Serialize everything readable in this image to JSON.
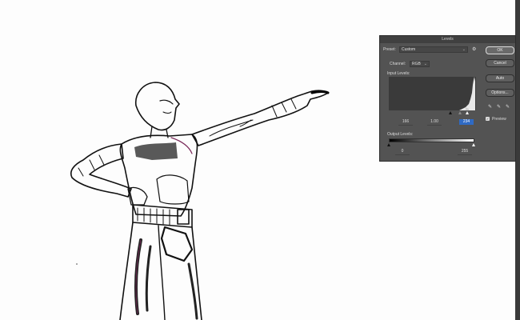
{
  "dialog": {
    "title": "Levels",
    "preset_label": "Preset:",
    "preset_value": "Custom",
    "channel_label": "Channel:",
    "channel_value": "RGB",
    "input_levels_label": "Input Levels:",
    "input_black": "166",
    "input_gamma": "1.00",
    "input_white": "234",
    "output_levels_label": "Output Levels:",
    "output_black": "0",
    "output_white": "255",
    "buttons": {
      "ok": "OK",
      "cancel": "Cancel",
      "auto": "Auto",
      "options": "Options..."
    },
    "preview_label": "Preview",
    "preview_checked": true,
    "icons": [
      "chevron-down-icon",
      "gear-icon",
      "black-eyedropper-icon",
      "gray-eyedropper-icon",
      "white-eyedropper-icon",
      "checkmark-icon"
    ]
  },
  "colors": {
    "dialog_bg": "#535353",
    "title_bg": "#404040",
    "accent": "#2f6ac4",
    "canvas_bg": "#fdfdfd"
  }
}
